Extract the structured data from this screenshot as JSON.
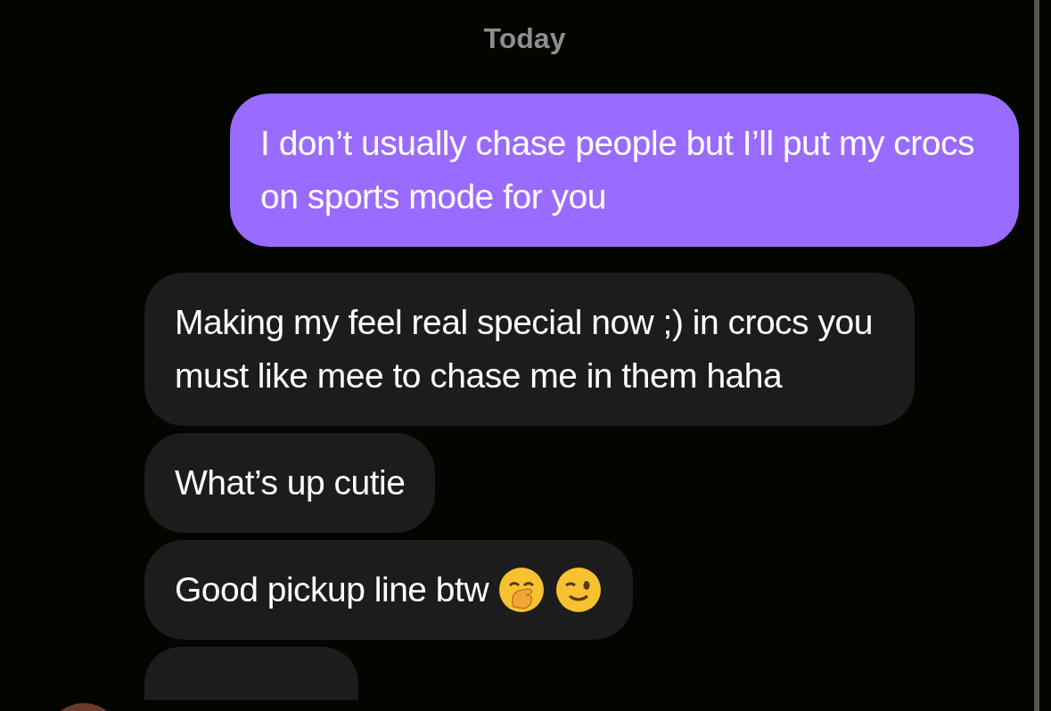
{
  "date_divider": "Today",
  "messages": [
    {
      "kind": "sent",
      "text": "I don’t usually chase people but I’ll put my crocs on sports mode for you"
    },
    {
      "kind": "received",
      "text": "Making my feel real special now ;) in crocs you must like mee to chase me in them haha"
    },
    {
      "kind": "received",
      "text": "What’s up cutie"
    },
    {
      "kind": "received-emoji",
      "text": "Good pickup line btw"
    }
  ]
}
